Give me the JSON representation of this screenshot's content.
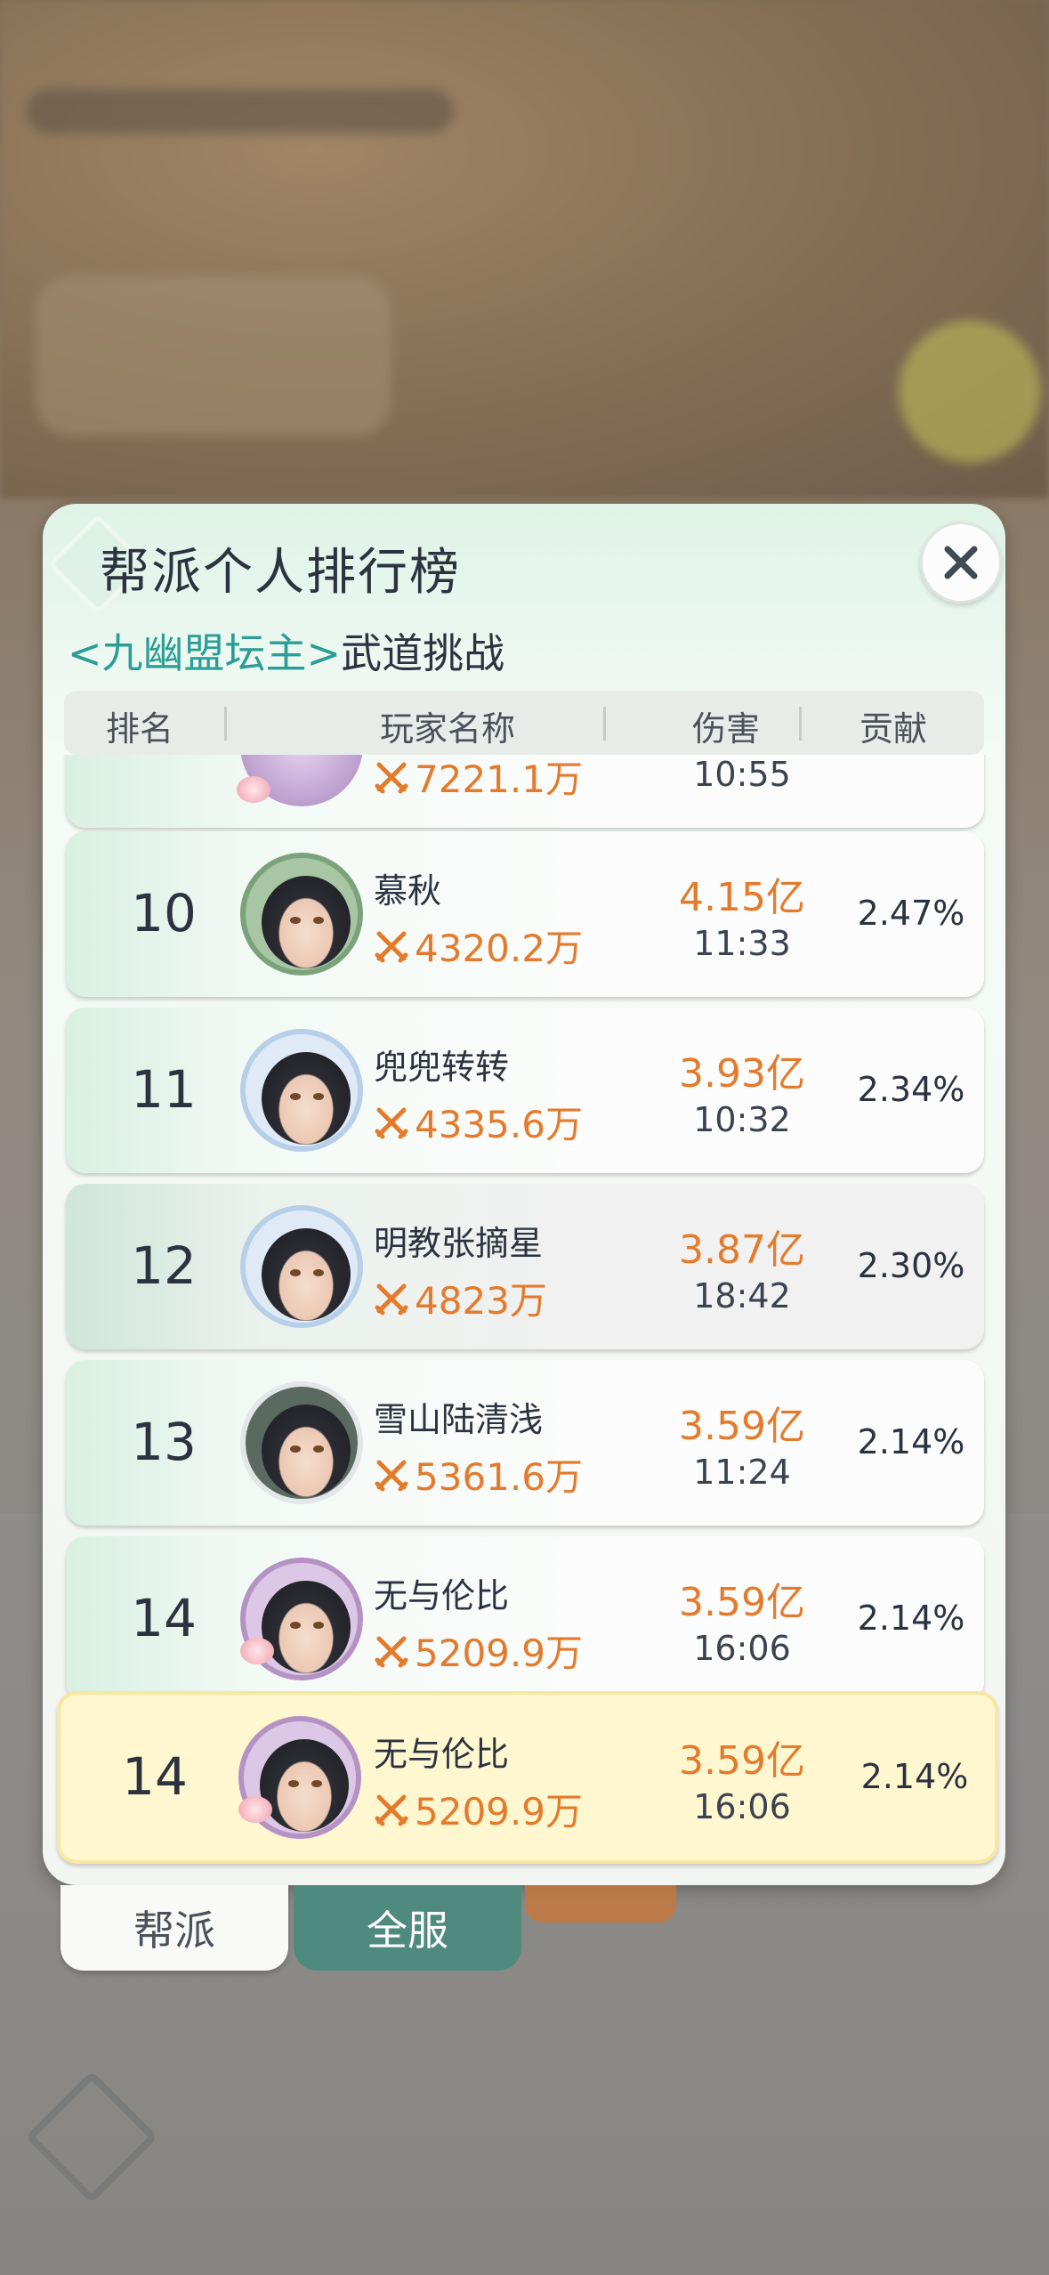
{
  "title": "帮派个人排行榜",
  "subtitle": {
    "boss": "<九幽盟坛主>",
    "event": "武道挑战"
  },
  "columns": [
    "排名",
    "玩家名称",
    "伤害",
    "贡献"
  ],
  "partial_row": {
    "power": "7221.1万",
    "time": "10:55"
  },
  "rows": [
    {
      "rank": "10",
      "name": "慕秋",
      "power": "4320.2万",
      "damage": "4.15亿",
      "time": "11:33",
      "contribution": "2.47%"
    },
    {
      "rank": "11",
      "name": "兜兜转转",
      "power": "4335.6万",
      "damage": "3.93亿",
      "time": "10:32",
      "contribution": "2.34%"
    },
    {
      "rank": "12",
      "name": "明教张摘星",
      "power": "4823万",
      "damage": "3.87亿",
      "time": "18:42",
      "contribution": "2.30%"
    },
    {
      "rank": "13",
      "name": "雪山陆清浅",
      "power": "5361.6万",
      "damage": "3.59亿",
      "time": "11:24",
      "contribution": "2.14%"
    },
    {
      "rank": "14",
      "name": "无与伦比",
      "power": "5209.9万",
      "damage": "3.59亿",
      "time": "16:06",
      "contribution": "2.14%"
    }
  ],
  "my_row": {
    "rank": "14",
    "name": "无与伦比",
    "power": "5209.9万",
    "damage": "3.59亿",
    "time": "16:06",
    "contribution": "2.14%"
  },
  "tabs": {
    "guild": "帮派",
    "all_server": "全服",
    "active": "all_server"
  },
  "colors": {
    "accent_orange": "#e47a2b",
    "teal": "#2a9d95",
    "active_tab": "#4e8a7e",
    "my_row_bg": "#fff7cf"
  }
}
